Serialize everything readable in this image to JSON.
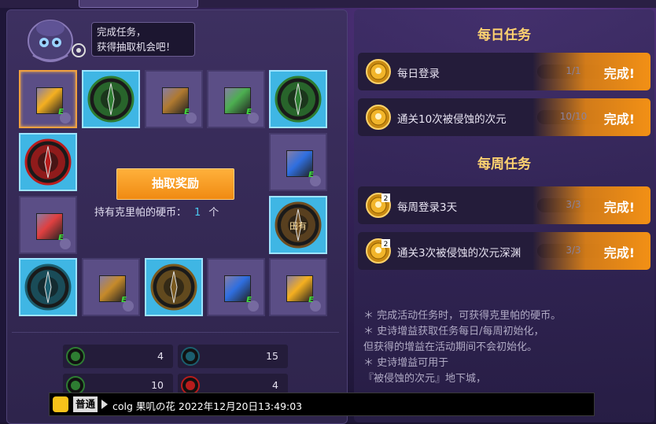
{
  "bubble": {
    "line1": "完成任务，",
    "line2": "获得抽取机会吧！"
  },
  "grid": {
    "cells": [
      {
        "kind": "item",
        "color": "#f5b020",
        "icon": "orange-gem-icon",
        "highlight": "selected"
      },
      {
        "kind": "emblem",
        "color": "#2e7d32",
        "icon": "green-armor-emblem-icon",
        "highlight": "cyan"
      },
      {
        "kind": "item",
        "color": "#b07a30",
        "icon": "treasure-box-icon",
        "highlight": "none"
      },
      {
        "kind": "item",
        "color": "#4caf50",
        "icon": "sword-icon",
        "highlight": "none"
      },
      {
        "kind": "emblem",
        "color": "#2e7d32",
        "icon": "green-check-emblem-icon",
        "highlight": "cyan"
      },
      {
        "kind": "emblem",
        "color": "#b71c1c",
        "icon": "red-emblem-icon",
        "highlight": "cyan"
      },
      {
        "kind": "item",
        "color": "#2f6fe0",
        "icon": "blue-swirl-icon",
        "highlight": "none"
      },
      {
        "kind": "item",
        "color": "#e04040",
        "icon": "red-gem-icon",
        "highlight": "none"
      },
      {
        "kind": "emblem",
        "color": "#6d4c21",
        "icon": "bronze-emblem-icon",
        "highlight": "cyan"
      },
      {
        "kind": "emblem",
        "color": "#1b5e6e",
        "icon": "teal-emblem-icon",
        "highlight": "cyan"
      },
      {
        "kind": "item",
        "color": "#c68a2a",
        "icon": "orange-book-icon",
        "highlight": "none"
      },
      {
        "kind": "emblem",
        "color": "#7a5a20",
        "icon": "gold-radar-emblem-icon",
        "highlight": "cyan"
      },
      {
        "kind": "item",
        "color": "#2f6fe0",
        "icon": "blue-swirl-icon",
        "highlight": "none"
      },
      {
        "kind": "item",
        "color": "#f5b020",
        "icon": "orange-gem-icon",
        "highlight": "none"
      }
    ],
    "item_badge": "E",
    "bronze_emblem_text": "田有"
  },
  "draw": {
    "button_label": "抽取奖励",
    "coins_label": "持有克里帕的硬币：",
    "coins_value": "1",
    "coins_unit": "个"
  },
  "counters": [
    {
      "icon": "green-emblem-icon",
      "color": "#2e7d32",
      "value": "4"
    },
    {
      "icon": "teal-emblem-icon",
      "color": "#1b5e6e",
      "value": "15"
    },
    {
      "icon": "green-armor-emblem-icon",
      "color": "#2e7d32",
      "value": "10"
    },
    {
      "icon": "red-emblem-icon",
      "color": "#b71c1c",
      "value": "4"
    }
  ],
  "daily": {
    "title": "每日任务",
    "tasks": [
      {
        "name": "每日登录",
        "progress": "1/1",
        "status": "完成!",
        "medal": ""
      },
      {
        "name": "通关10次被侵蚀的次元",
        "progress": "10/10",
        "status": "完成!",
        "medal": ""
      }
    ]
  },
  "weekly": {
    "title": "每周任务",
    "tasks": [
      {
        "name": "每周登录3天",
        "progress": "3/3",
        "status": "完成!",
        "medal": "2"
      },
      {
        "name": "通关3次被侵蚀的次元深渊",
        "progress": "3/3",
        "status": "完成!",
        "medal": "2"
      }
    ]
  },
  "notes": [
    "＊ 完成活动任务时，可获得克里帕的硬币。",
    "＊ 史诗增益获取任务每日/每周初始化，",
    "   但获得的增益在活动期间不会初始化。",
    "＊ 史诗增益可用于",
    "   『被侵蚀的次元』地下城，"
  ],
  "chat": {
    "channel": "普通",
    "message": "colg 果叽の花 2022年12月20日13:49:03"
  },
  "colors": {
    "accent_orange": "#f29015",
    "title_gold": "#ffd270",
    "cyan_cell": "#3fb6e4"
  }
}
